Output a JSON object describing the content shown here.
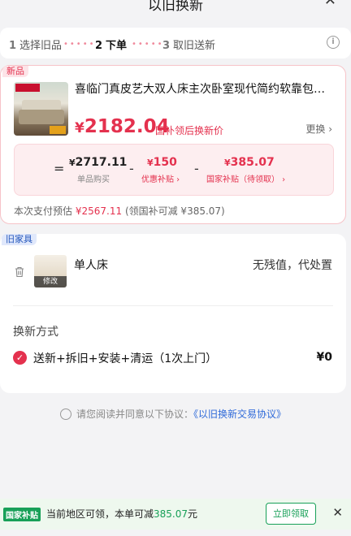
{
  "header": {
    "title": "以旧换新",
    "close": "✕"
  },
  "steps": [
    {
      "num": "1",
      "label": "选择旧品"
    },
    {
      "num": "2",
      "label": "下单"
    },
    {
      "num": "3",
      "label": "取旧送新"
    }
  ],
  "new_item": {
    "tag": "新品",
    "title": "喜临门真皮艺大双人床主次卧室现代简约软靠包…",
    "price_symbol": "¥",
    "price": "2182.04",
    "price_label": "国补领后换新价",
    "change_label": "更换 ›"
  },
  "calc": {
    "eq": "=",
    "minus": "-",
    "unit_price": "2717.11",
    "unit_label": "单品购买",
    "discount": "150",
    "discount_label": "优惠补贴 ›",
    "subsidy": "385.07",
    "subsidy_label": "国家补贴（待领取） ›",
    "yen": "¥"
  },
  "pay": {
    "prefix": "本次支付预估",
    "amount": "¥2567.11",
    "suffix": "(领国补可减 ¥385.07)"
  },
  "old_item": {
    "tag": "旧家具",
    "name": "单人床",
    "status": "无残值，代处置",
    "modify": "修改"
  },
  "method": {
    "title": "换新方式",
    "option": "送新+拆旧+安装+清运（1次上门）",
    "price": "¥0"
  },
  "agreement": {
    "prefix": "请您阅读并同意以下协议：",
    "link": "《以旧换新交易协议》"
  },
  "bottom": {
    "tag": "国家补贴",
    "text_prefix": "当前地区可领，本单可减",
    "amount": "385.07",
    "text_suffix": "元",
    "claim": "立即领取",
    "close": "✕"
  },
  "colors": {
    "accent": "#e4314e",
    "green": "#18a058",
    "link": "#2f6ad9"
  }
}
